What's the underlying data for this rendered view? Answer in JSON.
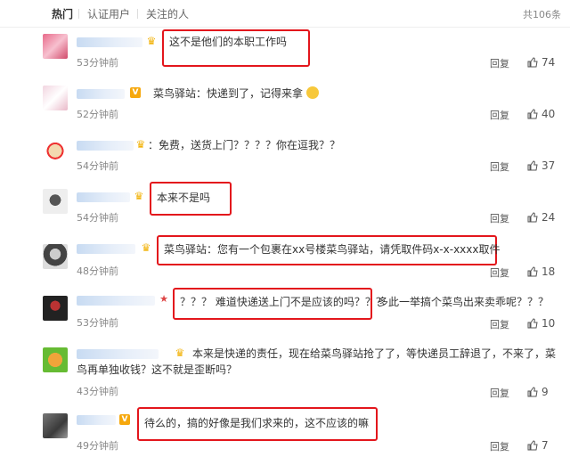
{
  "tabs": {
    "hot": "热门",
    "verified": "认证用户",
    "followed": "关注的人"
  },
  "total": "共106条",
  "comments": [
    {
      "text": "这不是他们的本职工作吗",
      "time": "53分钟前",
      "reply": "回复",
      "likes": "74"
    },
    {
      "text": "菜鸟驿站：快递到了，记得来拿",
      "time": "52分钟前",
      "reply": "回复",
      "likes": "40"
    },
    {
      "text": "：免费，送货上门？？？？你在逗我？？",
      "time": "54分钟前",
      "reply": "回复",
      "likes": "37"
    },
    {
      "text": "本来不是吗",
      "time": "54分钟前",
      "reply": "回复",
      "likes": "24"
    },
    {
      "text": "菜鸟驿站：您有一个包裹在xx号楼菜鸟驿站，请凭取件码x-x-xxxx取件",
      "time": "48分钟前",
      "reply": "回复",
      "likes": "18"
    },
    {
      "text": "？？？ 难道快递送上门不是应该的吗？？？",
      "text2": "多此一举搞个菜鸟出来卖乖呢？？？",
      "time": "53分钟前",
      "reply": "回复",
      "likes": "10"
    },
    {
      "text": "本来是快递的责任，现在给菜鸟驿站抢了了，等快递员工辞退了，不来了，菜鸟再单独收钱？这不就是歪断吗？",
      "time": "43分钟前",
      "reply": "回复",
      "likes": "9"
    },
    {
      "text": "待么的，搞的好像是我们求来的，这不应该的嘛",
      "time": "49分钟前",
      "reply": "回复",
      "likes": "7"
    }
  ],
  "colors": {
    "highlight": "#e3161c",
    "vip_badge": "#f6a80d"
  }
}
